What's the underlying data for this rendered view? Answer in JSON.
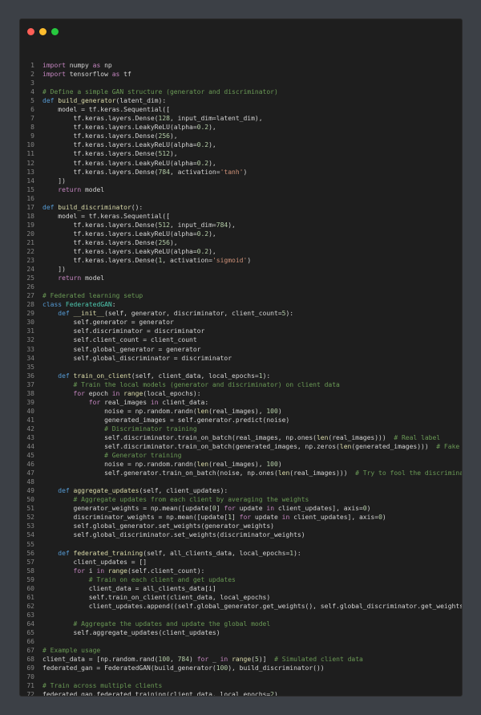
{
  "window": {
    "controls": [
      {
        "name": "close",
        "color": "#ff5f56"
      },
      {
        "name": "minimize",
        "color": "#ffbd2e"
      },
      {
        "name": "maximize",
        "color": "#27c93f"
      }
    ]
  },
  "colors": {
    "kw": "#c586c0",
    "blue": "#569cd6",
    "fn": "#dcdcaa",
    "cm": "#6a9955",
    "str": "#ce9178",
    "num": "#b5cea8",
    "cls": "#4ec9b0",
    "var": "#9cdcfe",
    "txt": "#d4d4d4"
  },
  "code": {
    "lines": [
      [
        [
          "kw",
          "import"
        ],
        [
          "txt",
          " numpy "
        ],
        [
          "kw",
          "as"
        ],
        [
          "txt",
          " np"
        ]
      ],
      [
        [
          "kw",
          "import"
        ],
        [
          "txt",
          " tensorflow "
        ],
        [
          "kw",
          "as"
        ],
        [
          "txt",
          " tf"
        ]
      ],
      [],
      [
        [
          "cm",
          "# Define a simple GAN structure (generator and discriminator)"
        ]
      ],
      [
        [
          "blue",
          "def"
        ],
        [
          "txt",
          " "
        ],
        [
          "fn",
          "build_generator"
        ],
        [
          "txt",
          "(latent_dim):"
        ]
      ],
      [
        [
          "txt",
          "    model = tf.keras.Sequential(["
        ]
      ],
      [
        [
          "txt",
          "        tf.keras.layers.Dense("
        ],
        [
          "num",
          "128"
        ],
        [
          "txt",
          ", input_dim=latent_dim),"
        ]
      ],
      [
        [
          "txt",
          "        tf.keras.layers.LeakyReLU(alpha="
        ],
        [
          "num",
          "0.2"
        ],
        [
          "txt",
          "),"
        ]
      ],
      [
        [
          "txt",
          "        tf.keras.layers.Dense("
        ],
        [
          "num",
          "256"
        ],
        [
          "txt",
          "),"
        ]
      ],
      [
        [
          "txt",
          "        tf.keras.layers.LeakyReLU(alpha="
        ],
        [
          "num",
          "0.2"
        ],
        [
          "txt",
          "),"
        ]
      ],
      [
        [
          "txt",
          "        tf.keras.layers.Dense("
        ],
        [
          "num",
          "512"
        ],
        [
          "txt",
          "),"
        ]
      ],
      [
        [
          "txt",
          "        tf.keras.layers.LeakyReLU(alpha="
        ],
        [
          "num",
          "0.2"
        ],
        [
          "txt",
          "),"
        ]
      ],
      [
        [
          "txt",
          "        tf.keras.layers.Dense("
        ],
        [
          "num",
          "784"
        ],
        [
          "txt",
          ", activation="
        ],
        [
          "str",
          "'tanh'"
        ],
        [
          "txt",
          ")"
        ]
      ],
      [
        [
          "txt",
          "    ])"
        ]
      ],
      [
        [
          "txt",
          "    "
        ],
        [
          "kw",
          "return"
        ],
        [
          "txt",
          " model"
        ]
      ],
      [],
      [
        [
          "blue",
          "def"
        ],
        [
          "txt",
          " "
        ],
        [
          "fn",
          "build_discriminator"
        ],
        [
          "txt",
          "():"
        ]
      ],
      [
        [
          "txt",
          "    model = tf.keras.Sequential(["
        ]
      ],
      [
        [
          "txt",
          "        tf.keras.layers.Dense("
        ],
        [
          "num",
          "512"
        ],
        [
          "txt",
          ", input_dim="
        ],
        [
          "num",
          "784"
        ],
        [
          "txt",
          "),"
        ]
      ],
      [
        [
          "txt",
          "        tf.keras.layers.LeakyReLU(alpha="
        ],
        [
          "num",
          "0.2"
        ],
        [
          "txt",
          "),"
        ]
      ],
      [
        [
          "txt",
          "        tf.keras.layers.Dense("
        ],
        [
          "num",
          "256"
        ],
        [
          "txt",
          "),"
        ]
      ],
      [
        [
          "txt",
          "        tf.keras.layers.LeakyReLU(alpha="
        ],
        [
          "num",
          "0.2"
        ],
        [
          "txt",
          "),"
        ]
      ],
      [
        [
          "txt",
          "        tf.keras.layers.Dense("
        ],
        [
          "num",
          "1"
        ],
        [
          "txt",
          ", activation="
        ],
        [
          "str",
          "'sigmoid'"
        ],
        [
          "txt",
          ")"
        ]
      ],
      [
        [
          "txt",
          "    ])"
        ]
      ],
      [
        [
          "txt",
          "    "
        ],
        [
          "kw",
          "return"
        ],
        [
          "txt",
          " model"
        ]
      ],
      [],
      [
        [
          "cm",
          "# Federated learning setup"
        ]
      ],
      [
        [
          "blue",
          "class"
        ],
        [
          "txt",
          " "
        ],
        [
          "cls",
          "FederatedGAN"
        ],
        [
          "txt",
          ":"
        ]
      ],
      [
        [
          "txt",
          "    "
        ],
        [
          "blue",
          "def"
        ],
        [
          "txt",
          " "
        ],
        [
          "fn",
          "__init__"
        ],
        [
          "txt",
          "(self, generator, discriminator, client_count="
        ],
        [
          "num",
          "5"
        ],
        [
          "txt",
          "):"
        ]
      ],
      [
        [
          "txt",
          "        self.generator = generator"
        ]
      ],
      [
        [
          "txt",
          "        self.discriminator = discriminator"
        ]
      ],
      [
        [
          "txt",
          "        self.client_count = client_count"
        ]
      ],
      [
        [
          "txt",
          "        self.global_generator = generator"
        ]
      ],
      [
        [
          "txt",
          "        self.global_discriminator = discriminator"
        ]
      ],
      [],
      [
        [
          "txt",
          "    "
        ],
        [
          "blue",
          "def"
        ],
        [
          "txt",
          " "
        ],
        [
          "fn",
          "train_on_client"
        ],
        [
          "txt",
          "(self, client_data, local_epochs="
        ],
        [
          "num",
          "1"
        ],
        [
          "txt",
          "):"
        ]
      ],
      [
        [
          "txt",
          "        "
        ],
        [
          "cm",
          "# Train the local models (generator and discriminator) on client data"
        ]
      ],
      [
        [
          "txt",
          "        "
        ],
        [
          "kw",
          "for"
        ],
        [
          "txt",
          " epoch "
        ],
        [
          "kw",
          "in"
        ],
        [
          "txt",
          " "
        ],
        [
          "fn",
          "range"
        ],
        [
          "txt",
          "(local_epochs):"
        ]
      ],
      [
        [
          "txt",
          "            "
        ],
        [
          "kw",
          "for"
        ],
        [
          "txt",
          " real_images "
        ],
        [
          "kw",
          "in"
        ],
        [
          "txt",
          " client_data:"
        ]
      ],
      [
        [
          "txt",
          "                noise = np.random.randn("
        ],
        [
          "fn",
          "len"
        ],
        [
          "txt",
          "(real_images), "
        ],
        [
          "num",
          "100"
        ],
        [
          "txt",
          ")"
        ]
      ],
      [
        [
          "txt",
          "                generated_images = self.generator.predict(noise)"
        ]
      ],
      [
        [
          "txt",
          "                "
        ],
        [
          "cm",
          "# Discriminator training"
        ]
      ],
      [
        [
          "txt",
          "                self.discriminator.train_on_batch(real_images, np.ones("
        ],
        [
          "fn",
          "len"
        ],
        [
          "txt",
          "(real_images)))  "
        ],
        [
          "cm",
          "# Real label"
        ]
      ],
      [
        [
          "txt",
          "                self.discriminator.train_on_batch(generated_images, np.zeros("
        ],
        [
          "fn",
          "len"
        ],
        [
          "txt",
          "(generated_images)))  "
        ],
        [
          "cm",
          "# Fake label"
        ]
      ],
      [
        [
          "txt",
          "                "
        ],
        [
          "cm",
          "# Generator training"
        ]
      ],
      [
        [
          "txt",
          "                noise = np.random.randn("
        ],
        [
          "fn",
          "len"
        ],
        [
          "txt",
          "(real_images), "
        ],
        [
          "num",
          "100"
        ],
        [
          "txt",
          ")"
        ]
      ],
      [
        [
          "txt",
          "                self.generator.train_on_batch(noise, np.ones("
        ],
        [
          "fn",
          "len"
        ],
        [
          "txt",
          "(real_images)))  "
        ],
        [
          "cm",
          "# Try to fool the discriminator"
        ]
      ],
      [],
      [
        [
          "txt",
          "    "
        ],
        [
          "blue",
          "def"
        ],
        [
          "txt",
          " "
        ],
        [
          "fn",
          "aggregate_updates"
        ],
        [
          "txt",
          "(self, client_updates):"
        ]
      ],
      [
        [
          "txt",
          "        "
        ],
        [
          "cm",
          "# Aggregate updates from each client by averaging the weights"
        ]
      ],
      [
        [
          "txt",
          "        generator_weights = np.mean([update["
        ],
        [
          "num",
          "0"
        ],
        [
          "txt",
          "] "
        ],
        [
          "kw",
          "for"
        ],
        [
          "txt",
          " update "
        ],
        [
          "kw",
          "in"
        ],
        [
          "txt",
          " client_updates], axis="
        ],
        [
          "num",
          "0"
        ],
        [
          "txt",
          ")"
        ]
      ],
      [
        [
          "txt",
          "        discriminator_weights = np.mean([update["
        ],
        [
          "num",
          "1"
        ],
        [
          "txt",
          "] "
        ],
        [
          "kw",
          "for"
        ],
        [
          "txt",
          " update "
        ],
        [
          "kw",
          "in"
        ],
        [
          "txt",
          " client_updates], axis="
        ],
        [
          "num",
          "0"
        ],
        [
          "txt",
          ")"
        ]
      ],
      [
        [
          "txt",
          "        self.global_generator.set_weights(generator_weights)"
        ]
      ],
      [
        [
          "txt",
          "        self.global_discriminator.set_weights(discriminator_weights)"
        ]
      ],
      [],
      [
        [
          "txt",
          "    "
        ],
        [
          "blue",
          "def"
        ],
        [
          "txt",
          " "
        ],
        [
          "fn",
          "federated_training"
        ],
        [
          "txt",
          "(self, all_clients_data, local_epochs="
        ],
        [
          "num",
          "1"
        ],
        [
          "txt",
          "):"
        ]
      ],
      [
        [
          "txt",
          "        client_updates = []"
        ]
      ],
      [
        [
          "txt",
          "        "
        ],
        [
          "kw",
          "for"
        ],
        [
          "txt",
          " i "
        ],
        [
          "kw",
          "in"
        ],
        [
          "txt",
          " "
        ],
        [
          "fn",
          "range"
        ],
        [
          "txt",
          "(self.client_count):"
        ]
      ],
      [
        [
          "txt",
          "            "
        ],
        [
          "cm",
          "# Train on each client and get updates"
        ]
      ],
      [
        [
          "txt",
          "            client_data = all_clients_data[i]"
        ]
      ],
      [
        [
          "txt",
          "            self.train_on_client(client_data, local_epochs)"
        ]
      ],
      [
        [
          "txt",
          "            client_updates.append((self.global_generator.get_weights(), self.global_discriminator.get_weights()))"
        ]
      ],
      [],
      [
        [
          "txt",
          "        "
        ],
        [
          "cm",
          "# Aggregate the updates and update the global model"
        ]
      ],
      [
        [
          "txt",
          "        self.aggregate_updates(client_updates)"
        ]
      ],
      [],
      [
        [
          "cm",
          "# Example usage"
        ]
      ],
      [
        [
          "txt",
          "client_data = [np.random.rand("
        ],
        [
          "num",
          "100"
        ],
        [
          "txt",
          ", "
        ],
        [
          "num",
          "784"
        ],
        [
          "txt",
          ") "
        ],
        [
          "kw",
          "for"
        ],
        [
          "txt",
          " _ "
        ],
        [
          "kw",
          "in"
        ],
        [
          "txt",
          " "
        ],
        [
          "fn",
          "range"
        ],
        [
          "txt",
          "("
        ],
        [
          "num",
          "5"
        ],
        [
          "txt",
          ")]  "
        ],
        [
          "cm",
          "# Simulated client data"
        ]
      ],
      [
        [
          "txt",
          "federated_gan = FederatedGAN(build_generator("
        ],
        [
          "num",
          "100"
        ],
        [
          "txt",
          "), build_discriminator())"
        ]
      ],
      [],
      [
        [
          "cm",
          "# Train across multiple clients"
        ]
      ],
      [
        [
          "txt",
          "federated_gan.federated_training(client_data, local_epochs="
        ],
        [
          "num",
          "2"
        ],
        [
          "txt",
          ")"
        ]
      ],
      []
    ]
  }
}
